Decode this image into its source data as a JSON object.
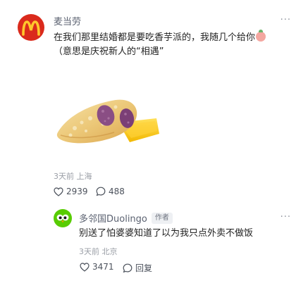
{
  "main_comment": {
    "author": "麦当劳",
    "more": "···",
    "text_line1": "在我们那里结婚都是要吃香芋派的，我随几个给你",
    "text_line2": "（意思是庆祝新人的“相遇”",
    "meta": "3天前 上海",
    "likes": "2939",
    "comments": "488",
    "avatar_icon": "mcdonalds-logo",
    "brand_color": "#da2a1c"
  },
  "reply": {
    "author": "多邻国Duolingo",
    "badge": "作者",
    "more": "···",
    "text": "别送了怕婆婆知道了以为我只点外卖不做饭",
    "meta": "3天前 北京",
    "likes": "3471",
    "reply_label": "回复",
    "avatar_icon": "duolingo-owl",
    "brand_color": "#58cc02"
  }
}
